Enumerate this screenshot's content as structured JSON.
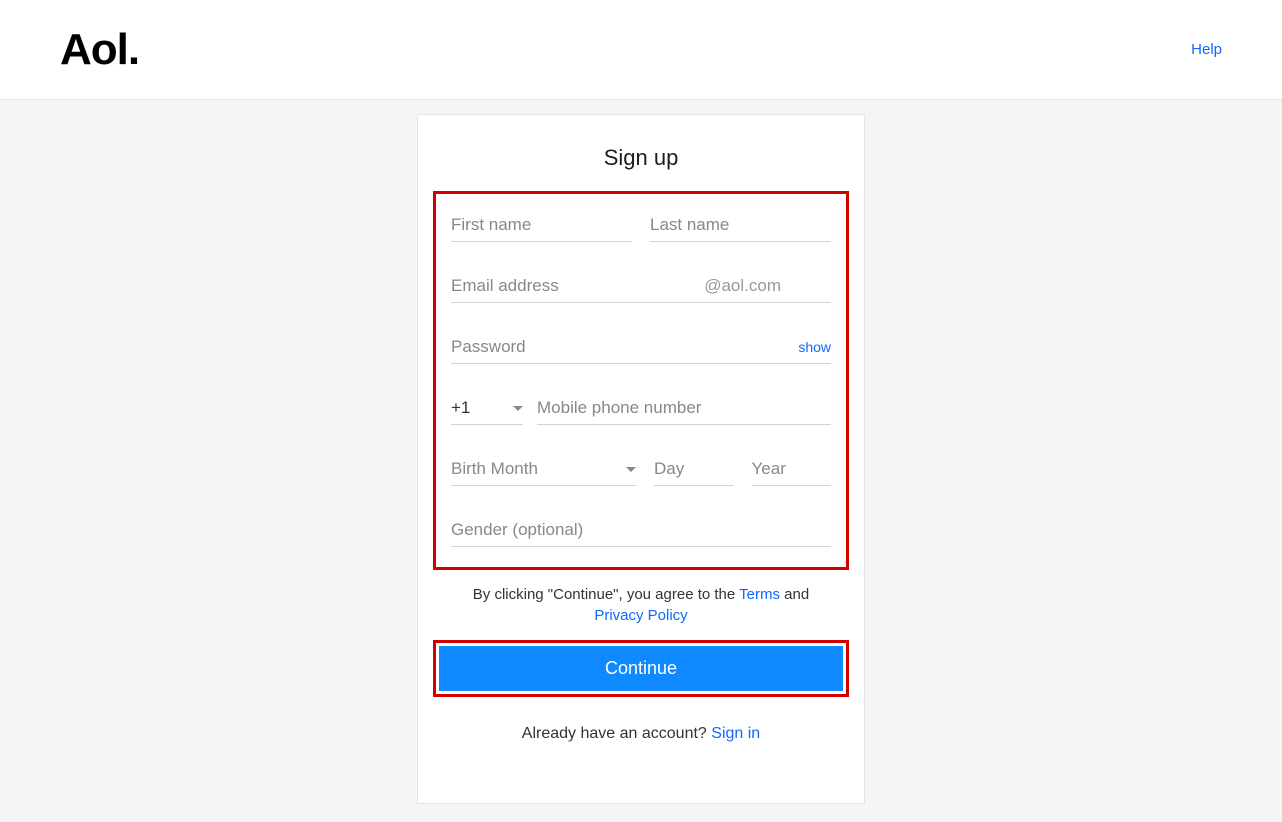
{
  "header": {
    "logo": "Aol.",
    "help": "Help"
  },
  "form": {
    "title": "Sign up",
    "first_name_placeholder": "First name",
    "last_name_placeholder": "Last name",
    "email_placeholder": "Email address",
    "email_suffix": "@aol.com",
    "password_placeholder": "Password",
    "show_label": "show",
    "country_code": "+1",
    "phone_placeholder": "Mobile phone number",
    "birth_month_placeholder": "Birth Month",
    "day_placeholder": "Day",
    "year_placeholder": "Year",
    "gender_placeholder": "Gender (optional)"
  },
  "terms": {
    "prefix": "By clicking \"Continue\", you agree to the ",
    "terms_link": "Terms",
    "middle": " and ",
    "privacy_link": "Privacy Policy"
  },
  "continue_label": "Continue",
  "signin": {
    "prefix": "Already have an account? ",
    "link": "Sign in"
  }
}
